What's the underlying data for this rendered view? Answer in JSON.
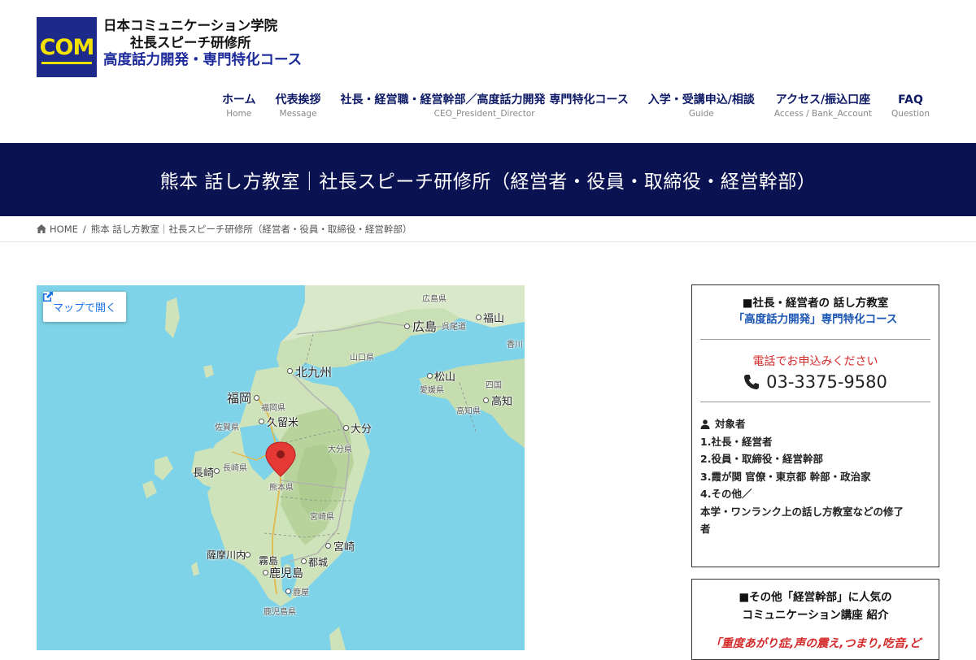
{
  "header": {
    "logo_mark": "COM",
    "logo_line1": "日本コミュニケーション学院",
    "logo_line2": "社長スピーチ研修所",
    "logo_line3": "高度話力開発・専門特化コース"
  },
  "nav": [
    {
      "label": "ホーム",
      "sub": "Home"
    },
    {
      "label": "代表挨拶",
      "sub": "Message"
    },
    {
      "label": "社長・経営職・経営幹部／高度話力開発 専門特化コース",
      "sub": "CEO_President_Director"
    },
    {
      "label": "入学・受講申込/相談",
      "sub": "Guide"
    },
    {
      "label": "アクセス/振込口座",
      "sub": "Access / Bank_Account"
    },
    {
      "label": "FAQ",
      "sub": "Question"
    }
  ],
  "page_title": "熊本 話し方教室｜社長スピーチ研修所（経営者・役員・取締役・経営幹部）",
  "breadcrumb": {
    "home": "HOME",
    "sep": "/",
    "current": "熊本 話し方教室｜社長スピーチ研修所（経営者・役員・取締役・経営幹部）"
  },
  "map": {
    "open_label": "マップで開く",
    "labels": {
      "hiroshima_pref": "広島県",
      "fukuyama": "福山",
      "hiroshima": "広島",
      "kure": "呉",
      "onomichi": "尾道",
      "kagawa": "香川",
      "yamaguchi": "山口県",
      "kitakyushu": "北九州",
      "matsuyama": "松山",
      "ehime": "愛媛県",
      "shikoku": "四国",
      "kochi": "高知",
      "kochi_pref": "高知県",
      "fukuoka": "福岡",
      "fukuoka_pref": "福岡県",
      "kurume": "久留米",
      "saga": "佐賀県",
      "oita": "大分",
      "oita_pref": "大分県",
      "nagasaki": "長崎",
      "nagasaki_pref": "長崎県",
      "kumamoto": "熊本県",
      "miyazaki_pref": "宮崎県",
      "miyazaki": "宮崎",
      "satsumasendai": "薩摩川内",
      "kirishima": "霧島",
      "miyakonojo": "都城",
      "kagoshima": "鹿児島",
      "kanoya": "鹿屋",
      "kagoshima_pref": "鹿児島県"
    }
  },
  "sidebar": {
    "box1_head1": "■社長・経営者の 話し方教室",
    "box1_head2": "「高度話力開発」専門特化コース",
    "call_text": "電話でお申込みください",
    "phone": "03-3375-9580",
    "target_head": "対象者",
    "targets": [
      "1.社長・経営者",
      "2.役員・取締役・経営幹部",
      "3.霞が関 官僚・東京都 幹部・政治家",
      "4.その他／",
      "本学・ワンランク上の話し方教室などの修了",
      "者"
    ],
    "box2_head1": "■その他「経営幹部」に人気の",
    "box2_head2": "コミュニケーション講座 紹介",
    "box2_red": "「重度あがり症,声の震え,つまり,吃音,ど"
  },
  "colors": {
    "navy": "#0b1252",
    "nav_text": "#0e1a66",
    "accent_blue": "#1a55b3",
    "red": "#d42b2b",
    "logo_yellow": "#f4e200"
  }
}
